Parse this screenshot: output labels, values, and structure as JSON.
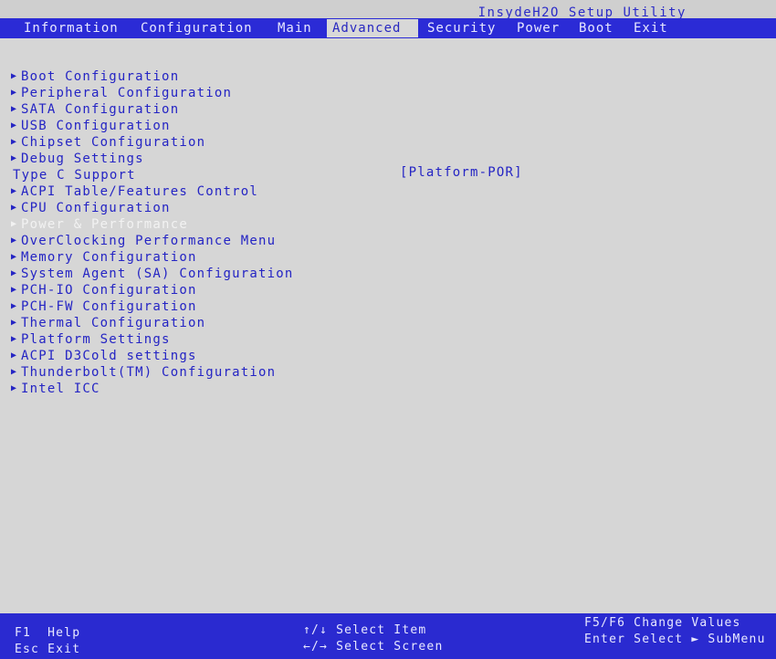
{
  "app": {
    "title": "InsydeH2O Setup Utility"
  },
  "tabs": [
    {
      "label": "Information"
    },
    {
      "label": "Configuration"
    },
    {
      "label": "Main"
    },
    {
      "label": "Advanced",
      "active": true
    },
    {
      "label": "Security"
    },
    {
      "label": "Power"
    },
    {
      "label": "Boot"
    },
    {
      "label": "Exit"
    }
  ],
  "menu": [
    {
      "label": "Boot Configuration",
      "submenu": true
    },
    {
      "label": "Peripheral Configuration",
      "submenu": true
    },
    {
      "label": "SATA Configuration",
      "submenu": true
    },
    {
      "label": "USB Configuration",
      "submenu": true
    },
    {
      "label": "Chipset Configuration",
      "submenu": true
    },
    {
      "label": "Debug Settings",
      "submenu": true
    },
    {
      "label": "Type C Support",
      "submenu": false,
      "value": "[Platform-POR]"
    },
    {
      "label": "ACPI Table/Features Control",
      "submenu": true
    },
    {
      "label": "CPU Configuration",
      "submenu": true
    },
    {
      "label": "Power & Performance",
      "submenu": true,
      "selected": true
    },
    {
      "label": "OverClocking Performance Menu",
      "submenu": true
    },
    {
      "label": "Memory Configuration",
      "submenu": true
    },
    {
      "label": "System Agent (SA) Configuration",
      "submenu": true
    },
    {
      "label": "PCH-IO Configuration",
      "submenu": true
    },
    {
      "label": "PCH-FW Configuration",
      "submenu": true
    },
    {
      "label": "Thermal Configuration",
      "submenu": true
    },
    {
      "label": "Platform Settings",
      "submenu": true
    },
    {
      "label": "ACPI D3Cold settings",
      "submenu": true
    },
    {
      "label": "Thunderbolt(TM) Configuration",
      "submenu": true
    },
    {
      "label": "Intel ICC",
      "submenu": true
    }
  ],
  "help": {
    "f1": "F1",
    "f1_action": "Help",
    "esc": "Esc",
    "esc_action": "Exit",
    "updown": "↑/↓",
    "updown_action": "Select Item",
    "leftright": "←/→",
    "leftright_action": "Select Screen",
    "f5f6": "F5/F6",
    "f5f6_action": "Change Values",
    "enter": "Enter",
    "enter_action": "Select ► SubMenu"
  },
  "colors": {
    "background": "#d6d6d6",
    "accent": "#2b2bd6",
    "text": "#2424c4",
    "highlight": "#f2f2f2"
  }
}
